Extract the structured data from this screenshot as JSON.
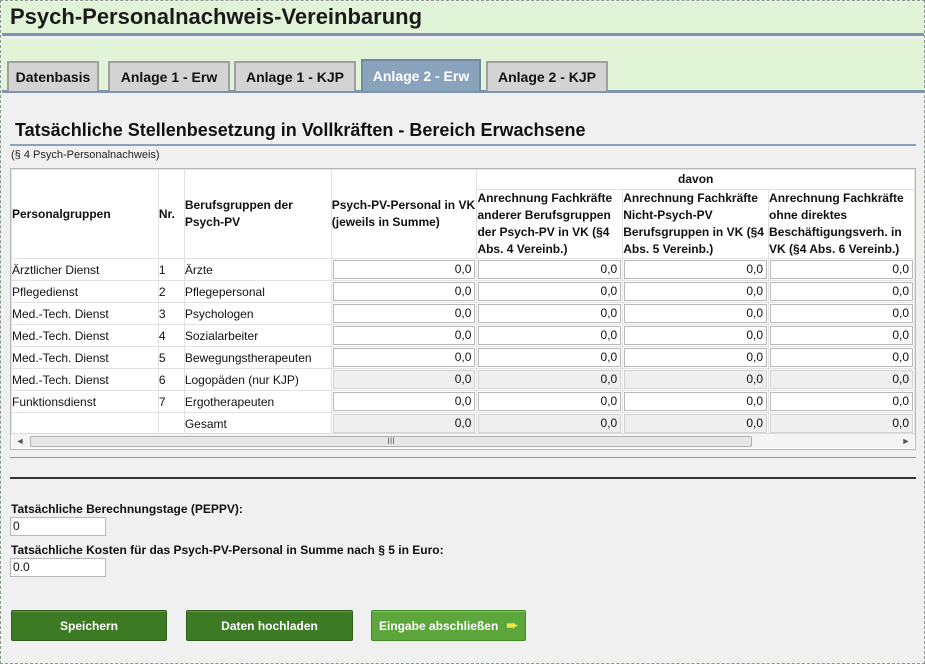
{
  "app": {
    "title": "Psych-Personalnachweis-Vereinbarung"
  },
  "tabs": [
    {
      "label": "Datenbasis",
      "active": false
    },
    {
      "label": "Anlage 1 - Erw",
      "active": false
    },
    {
      "label": "Anlage 1 - KJP",
      "active": false
    },
    {
      "label": "Anlage 2 - Erw",
      "active": true
    },
    {
      "label": "Anlage 2 - KJP",
      "active": false
    }
  ],
  "section": {
    "title": "Tatsächliche Stellenbesetzung in Vollkräften - Bereich Erwachsene",
    "subtitle": "(§ 4 Psych-Personalnachweis)"
  },
  "table": {
    "davon_label": "davon",
    "headers": {
      "group": "Personalgruppen",
      "nr": "Nr.",
      "berufsgruppe": "Berufsgruppen der Psych-PV",
      "psych": "Psych-PV-Personal in VK (jeweils in Summe)",
      "anr_anderer": "Anrechnung Fachkräfte anderer Berufsgruppen der Psych-PV in VK (§4 Abs. 4 Vereinb.)",
      "anr_nicht": "Anrechnung Fachkräfte Nicht-Psych-PV Berufsgruppen in VK (§4 Abs. 5 Vereinb.)",
      "anr_ohne": "Anrechnung Fachkräfte ohne direktes Beschäftigungsverh. in VK (§4 Abs. 6 Vereinb.)"
    },
    "rows": [
      {
        "group": "Ärztlicher Dienst",
        "nr": "1",
        "beruf": "Ärzte",
        "v1": "0,0",
        "v2": "0,0",
        "v3": "0,0",
        "v4": "0,0"
      },
      {
        "group": "Pflegedienst",
        "nr": "2",
        "beruf": "Pflegepersonal",
        "v1": "0,0",
        "v2": "0,0",
        "v3": "0,0",
        "v4": "0,0"
      },
      {
        "group": "Med.-Tech. Dienst",
        "nr": "3",
        "beruf": "Psychologen",
        "v1": "0,0",
        "v2": "0,0",
        "v3": "0,0",
        "v4": "0,0"
      },
      {
        "group": "Med.-Tech. Dienst",
        "nr": "4",
        "beruf": "Sozialarbeiter",
        "v1": "0,0",
        "v2": "0,0",
        "v3": "0,0",
        "v4": "0,0"
      },
      {
        "group": "Med.-Tech. Dienst",
        "nr": "5",
        "beruf": "Bewegungstherapeuten",
        "v1": "0,0",
        "v2": "0,0",
        "v3": "0,0",
        "v4": "0,0"
      },
      {
        "group": "Med.-Tech. Dienst",
        "nr": "6",
        "beruf": "Logopäden (nur KJP)",
        "v1": "0,0",
        "v2": "0,0",
        "v3": "0,0",
        "v4": "0,0"
      },
      {
        "group": "Funktionsdienst",
        "nr": "7",
        "beruf": "Ergotherapeuten",
        "v1": "0,0",
        "v2": "0,0",
        "v3": "0,0",
        "v4": "0,0"
      },
      {
        "group": "",
        "nr": "",
        "beruf": "Gesamt",
        "v1": "0,0",
        "v2": "0,0",
        "v3": "0,0",
        "v4": "0,0"
      }
    ],
    "scroll_thumb_label": "III"
  },
  "form": {
    "tage_label": "Tatsächliche Berechnungstage (PEPPV):",
    "tage_value": "0",
    "kosten_label": "Tatsächliche Kosten für das Psych-PV-Personal in Summe nach § 5 in Euro:",
    "kosten_value": "0.0"
  },
  "buttons": {
    "save": "Speichern",
    "upload": "Daten hochladen",
    "finish": "Eingabe abschließen"
  },
  "colors": {
    "accent": "#8aa3bd",
    "header_bg": "#e2f4d8",
    "button": "#3c7a24"
  }
}
